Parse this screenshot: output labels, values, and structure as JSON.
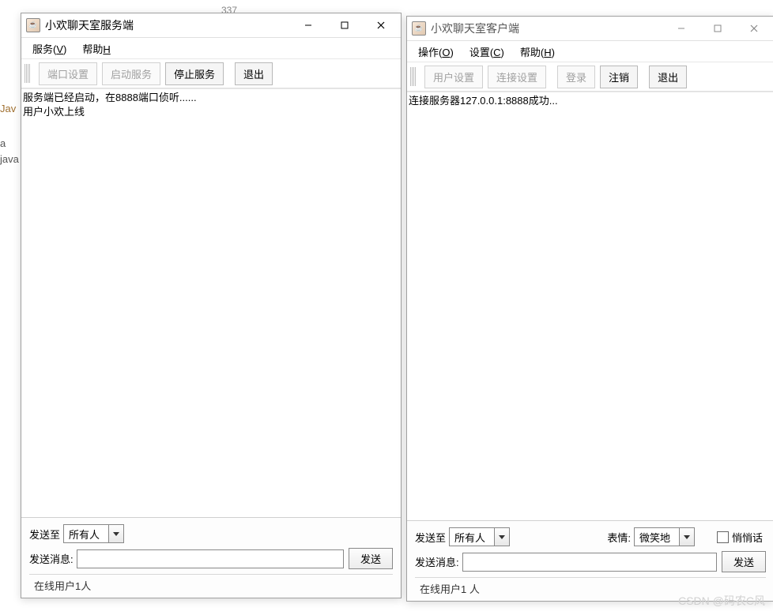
{
  "bg": {
    "java": "Jav",
    "a": "a",
    "java2": "java",
    "tab": "337"
  },
  "server": {
    "title": "小欢聊天室服务端",
    "menu": {
      "service": "服务(<u>V</u>)",
      "help": "帮助<u>H</u>"
    },
    "toolbar": {
      "port_cfg": "端口设置",
      "start": "启动服务",
      "stop": "停止服务",
      "exit": "退出"
    },
    "log": "服务端已经启动，在8888端口侦听......\n用户小欢上线",
    "send_to_lbl": "发送至",
    "send_to_val": "所有人",
    "msg_lbl": "发送消息:",
    "send_btn": "发送",
    "status": "在线用户1人"
  },
  "client": {
    "title": "小欢聊天室客户端",
    "menu": {
      "op": "操作(<u>O</u>)",
      "set": "设置(<u>C</u>)",
      "help": "帮助(<u>H</u>)"
    },
    "toolbar": {
      "user_cfg": "用户设置",
      "conn_cfg": "连接设置",
      "login": "登录",
      "logout": "注销",
      "exit": "退出"
    },
    "log": "连接服务器127.0.0.1:8888成功...",
    "send_to_lbl": "发送至",
    "send_to_val": "所有人",
    "emoji_lbl": "表情:",
    "emoji_val": "微笑地",
    "whisper_lbl": "悄悄话",
    "msg_lbl": "发送消息:",
    "send_btn": "发送",
    "status": "在线用户1 人"
  },
  "watermark": "CSDN @码农C风"
}
